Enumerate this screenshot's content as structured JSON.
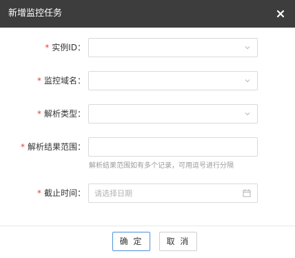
{
  "dialog": {
    "title": "新增监控任务"
  },
  "form": {
    "required_mark": "*",
    "instance_id": {
      "label": "实例ID：",
      "value": ""
    },
    "domain": {
      "label": "监控域名：",
      "value": ""
    },
    "resolve_type": {
      "label": "解析类型：",
      "value": ""
    },
    "resolve_range": {
      "label": "解析结果范围：",
      "value": "",
      "hint": "解析结果范围如有多个记录，可用逗号进行分隔"
    },
    "deadline": {
      "label": "截止时间：",
      "placeholder": "请选择日期"
    }
  },
  "footer": {
    "ok_label": "确 定",
    "cancel_label": "取 消"
  },
  "colors": {
    "header_bg": "#3d3d3d",
    "required": "#e0403a",
    "ok_border": "#4a90d9"
  },
  "icons": [
    "close-icon",
    "chevron-down-icon",
    "calendar-icon"
  ]
}
